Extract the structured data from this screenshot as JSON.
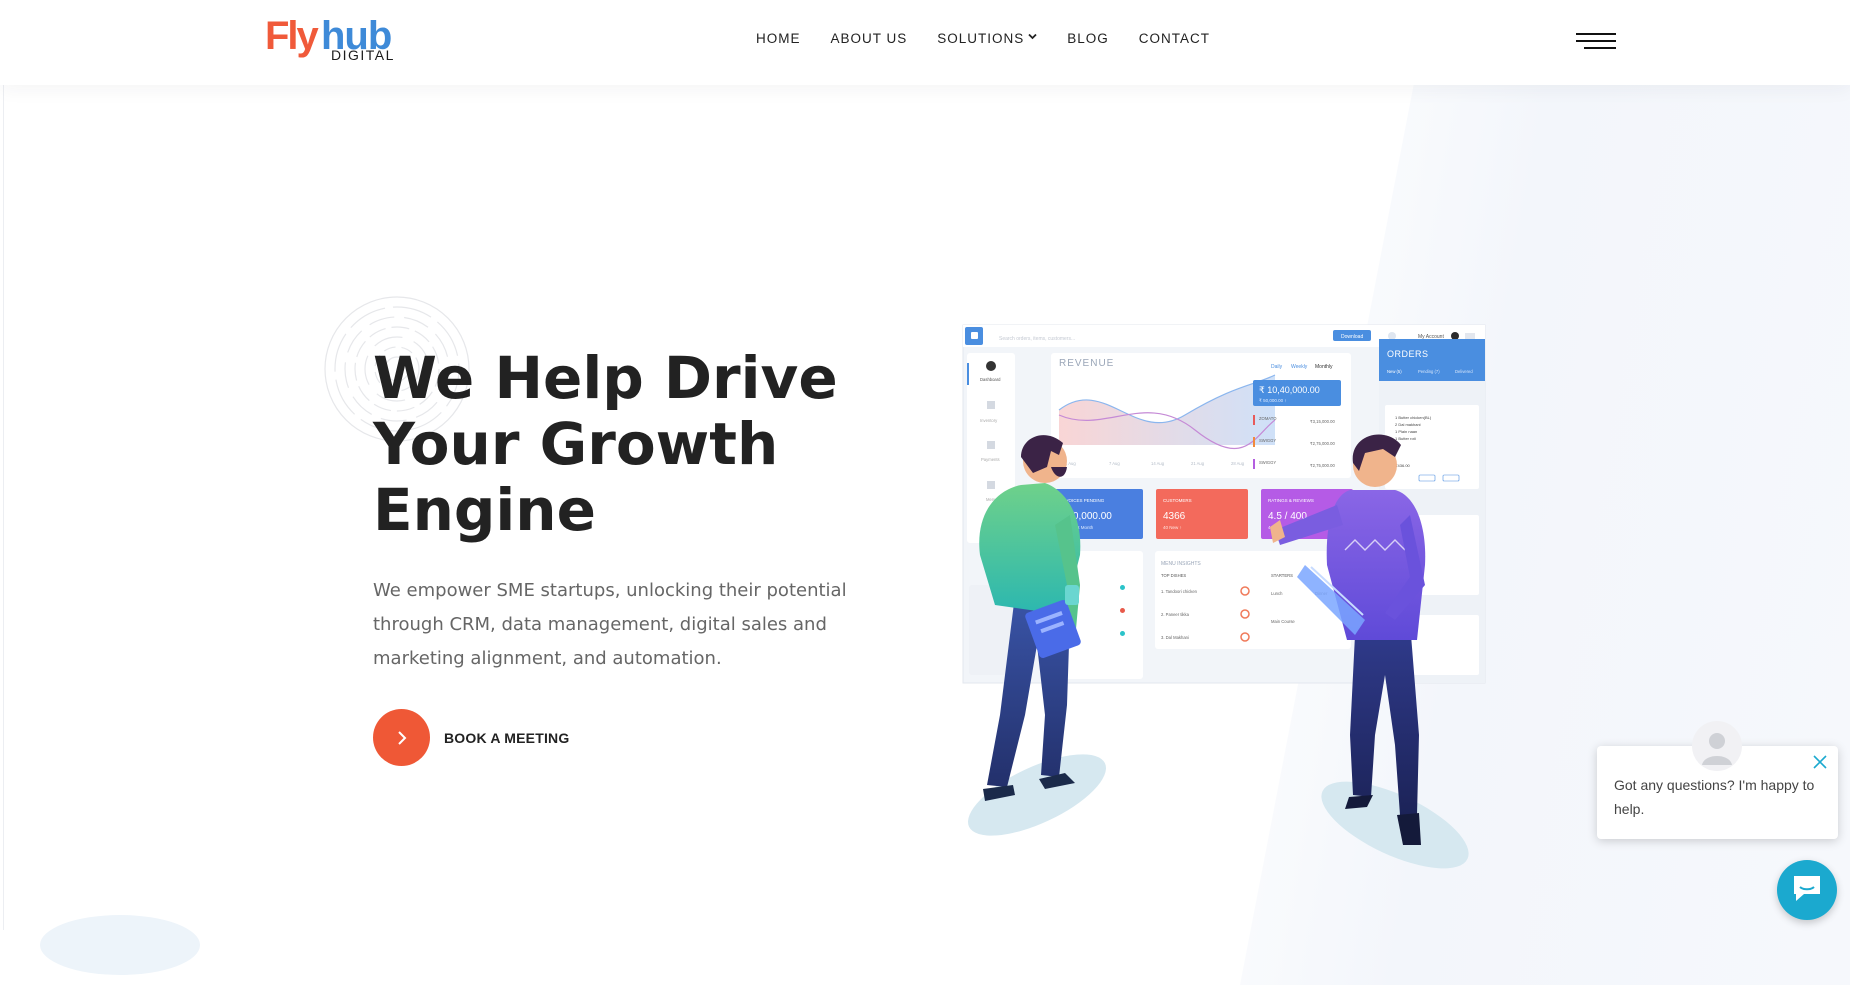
{
  "header": {
    "logo": {
      "word_fly": "Fly",
      "word_hub": "hub",
      "subtitle": "DIGITAL"
    },
    "nav": [
      {
        "label": "HOME"
      },
      {
        "label": "ABOUT US"
      },
      {
        "label": "SOLUTIONS",
        "has_dropdown": true,
        "icon": "chevron-down-icon"
      },
      {
        "label": "BLOG"
      },
      {
        "label": "CONTACT"
      }
    ],
    "menu_icon": "hamburger-icon"
  },
  "hero": {
    "title_line1": "We Help Drive",
    "title_line2": "Your Growth",
    "title_line3": "Engine",
    "description": "We empower SME startups, unlocking their potential through CRM, data management, digital sales and marketing alignment, and automation.",
    "cta_label": "BOOK A MEETING",
    "cta_icon": "chevron-right-icon"
  },
  "illustration": {
    "search_placeholder": "Search orders, items, customers...",
    "top_button": "Download",
    "account_label": "My Account",
    "revenue_title": "REVENUE",
    "period_tabs": [
      "Daily",
      "Weekly",
      "Monthly"
    ],
    "revenue_total": "₹ 10,40,000.00",
    "revenue_sub": "₹ 50,000.00 ↑",
    "revenue_rows": [
      {
        "name": "ZOMATO",
        "value": "₹3,15,000.00",
        "color": "#e85a5a"
      },
      {
        "name": "SWIGGY",
        "value": "₹2,75,000.00",
        "color": "#f28a3c"
      },
      {
        "name": "SWIGGY",
        "value": "₹2,75,000.00",
        "color": "#b45fe0"
      },
      {
        "name": "SELF",
        "value": "₹4,50,000.00",
        "color": "#4a7fe0"
      }
    ],
    "chart_ticks": [
      "1 Aug",
      "7 Aug",
      "14 Aug",
      "21 Aug",
      "28 Aug"
    ],
    "side_items": [
      "Dashboard",
      "Inventory",
      "Payments",
      "Menu"
    ],
    "cards": [
      {
        "title": "INVOICES PENDING",
        "value": "₹10,000.00",
        "sub": "than Last Month",
        "color": "#4a7fe0"
      },
      {
        "title": "CUSTOMERS",
        "value": "4366",
        "sub": "40 New ↑",
        "color": "#f0645a"
      },
      {
        "title": "RATINGS & REVIEWS",
        "value": "4.5 / 400",
        "sub": "4.5 ↑",
        "color": "#b45fe0"
      }
    ],
    "menu_insights": "MENU INSIGHTS",
    "menu_cols": [
      "TOP DISHES",
      "STARTERS"
    ],
    "menu_rows": [
      "1. Tandoori chicken",
      "2. Paneer tikka",
      "3. Dal Makhani"
    ],
    "meal_labels": [
      "Lunch",
      "Dinner",
      "Main Course"
    ],
    "orders_title": "ORDERS",
    "orders_tabs": [
      "New (5)",
      "Pending (7)",
      "Delivered"
    ],
    "order_lines": [
      "1 Butter chicken(BL)",
      "2 Dal makhani",
      "1 Plain naan",
      "1 Butter roti"
    ],
    "order_total": "₹436.00"
  },
  "chat": {
    "message": "Got any questions? I'm happy to help.",
    "close_icon": "close-icon",
    "launcher_icon": "chat-icon",
    "avatar_icon": "avatar-icon"
  },
  "colors": {
    "brand_orange": "#ef5836",
    "brand_blue": "#3e8ad8",
    "chat_teal": "#1ba9cf"
  }
}
